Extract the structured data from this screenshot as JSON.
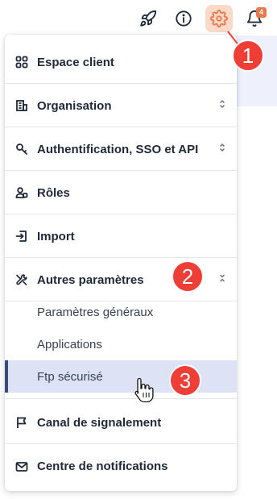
{
  "topbar": {
    "icons": [
      "rocket-icon",
      "info-icon",
      "gear-icon",
      "bell-icon"
    ],
    "notification_count": "4",
    "accent": "#e8794a"
  },
  "callouts": [
    "1",
    "2",
    "3"
  ],
  "menu": {
    "items": [
      {
        "label": "Espace client",
        "icon": "grid-icon"
      },
      {
        "label": "Organisation",
        "icon": "building-icon"
      },
      {
        "label": "Authentification, SSO et API",
        "icon": "key-icon"
      },
      {
        "label": "Rôles",
        "icon": "users-icon"
      },
      {
        "label": "Import",
        "icon": "import-icon"
      },
      {
        "label": "Autres paramètres",
        "icon": "tools-icon"
      },
      {
        "label": "Canal de signalement",
        "icon": "flag-icon"
      },
      {
        "label": "Centre de notifications",
        "icon": "mail-icon"
      }
    ],
    "subitems": [
      {
        "label": "Paramètres généraux"
      },
      {
        "label": "Applications"
      },
      {
        "label": "Ftp sécurisé",
        "active": true
      }
    ]
  }
}
